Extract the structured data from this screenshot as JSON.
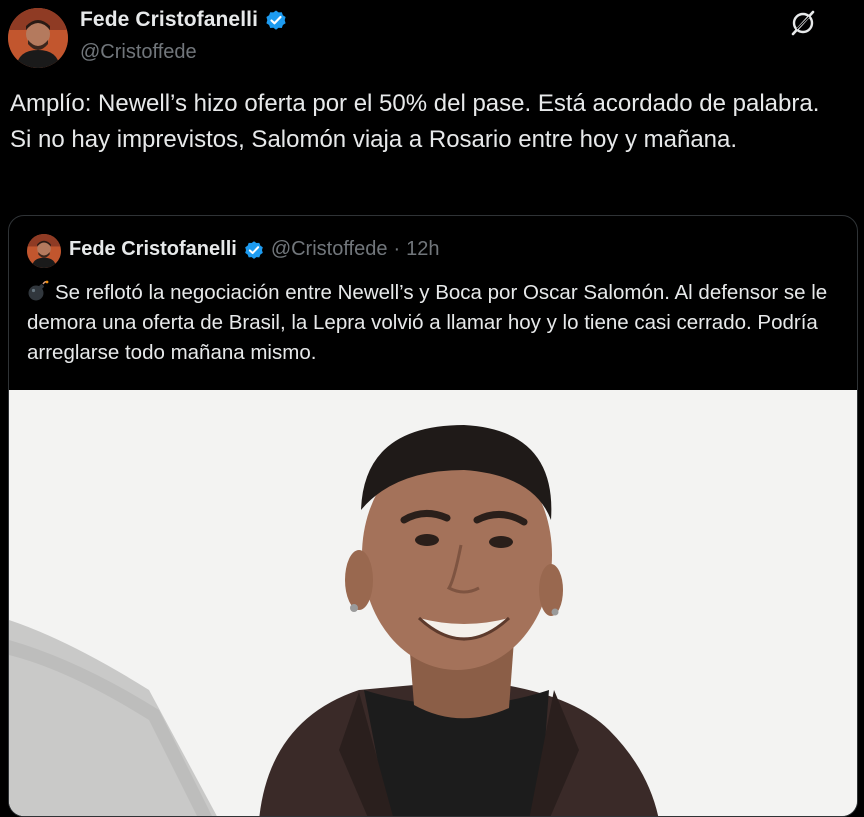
{
  "post": {
    "author": {
      "display_name": "Fede Cristofanelli",
      "handle": "@Cristoffede"
    },
    "text": "Amplío: Newell’s hizo oferta por el 50% del pase. Está acordado de palabra. Si no hay imprevistos, Salomón viaja a Rosario entre hoy y mañana."
  },
  "quoted_post": {
    "author": {
      "display_name": "Fede Cristofanelli",
      "handle": "@Cristoffede"
    },
    "separator": "·",
    "timestamp": "12h",
    "emoji": "💣",
    "text": "Se reflotó la negociación entre Newell’s y Boca por Oscar Salomón. Al defensor se le demora una oferta de Brasil, la Lepra volvió a llamar hoy y lo tiene casi cerrado. Podría arreglarse todo mañana mismo.",
    "media": {
      "kind": "photo"
    }
  },
  "icons": {
    "verified": "verified-badge-icon",
    "grok": "grok-icon",
    "bomb": "bomb-emoji-icon"
  },
  "colors": {
    "background": "#000000",
    "text_primary": "#e7e9ea",
    "text_secondary": "#71767b",
    "verified_blue": "#1d9bf0",
    "border": "#2f3336"
  }
}
